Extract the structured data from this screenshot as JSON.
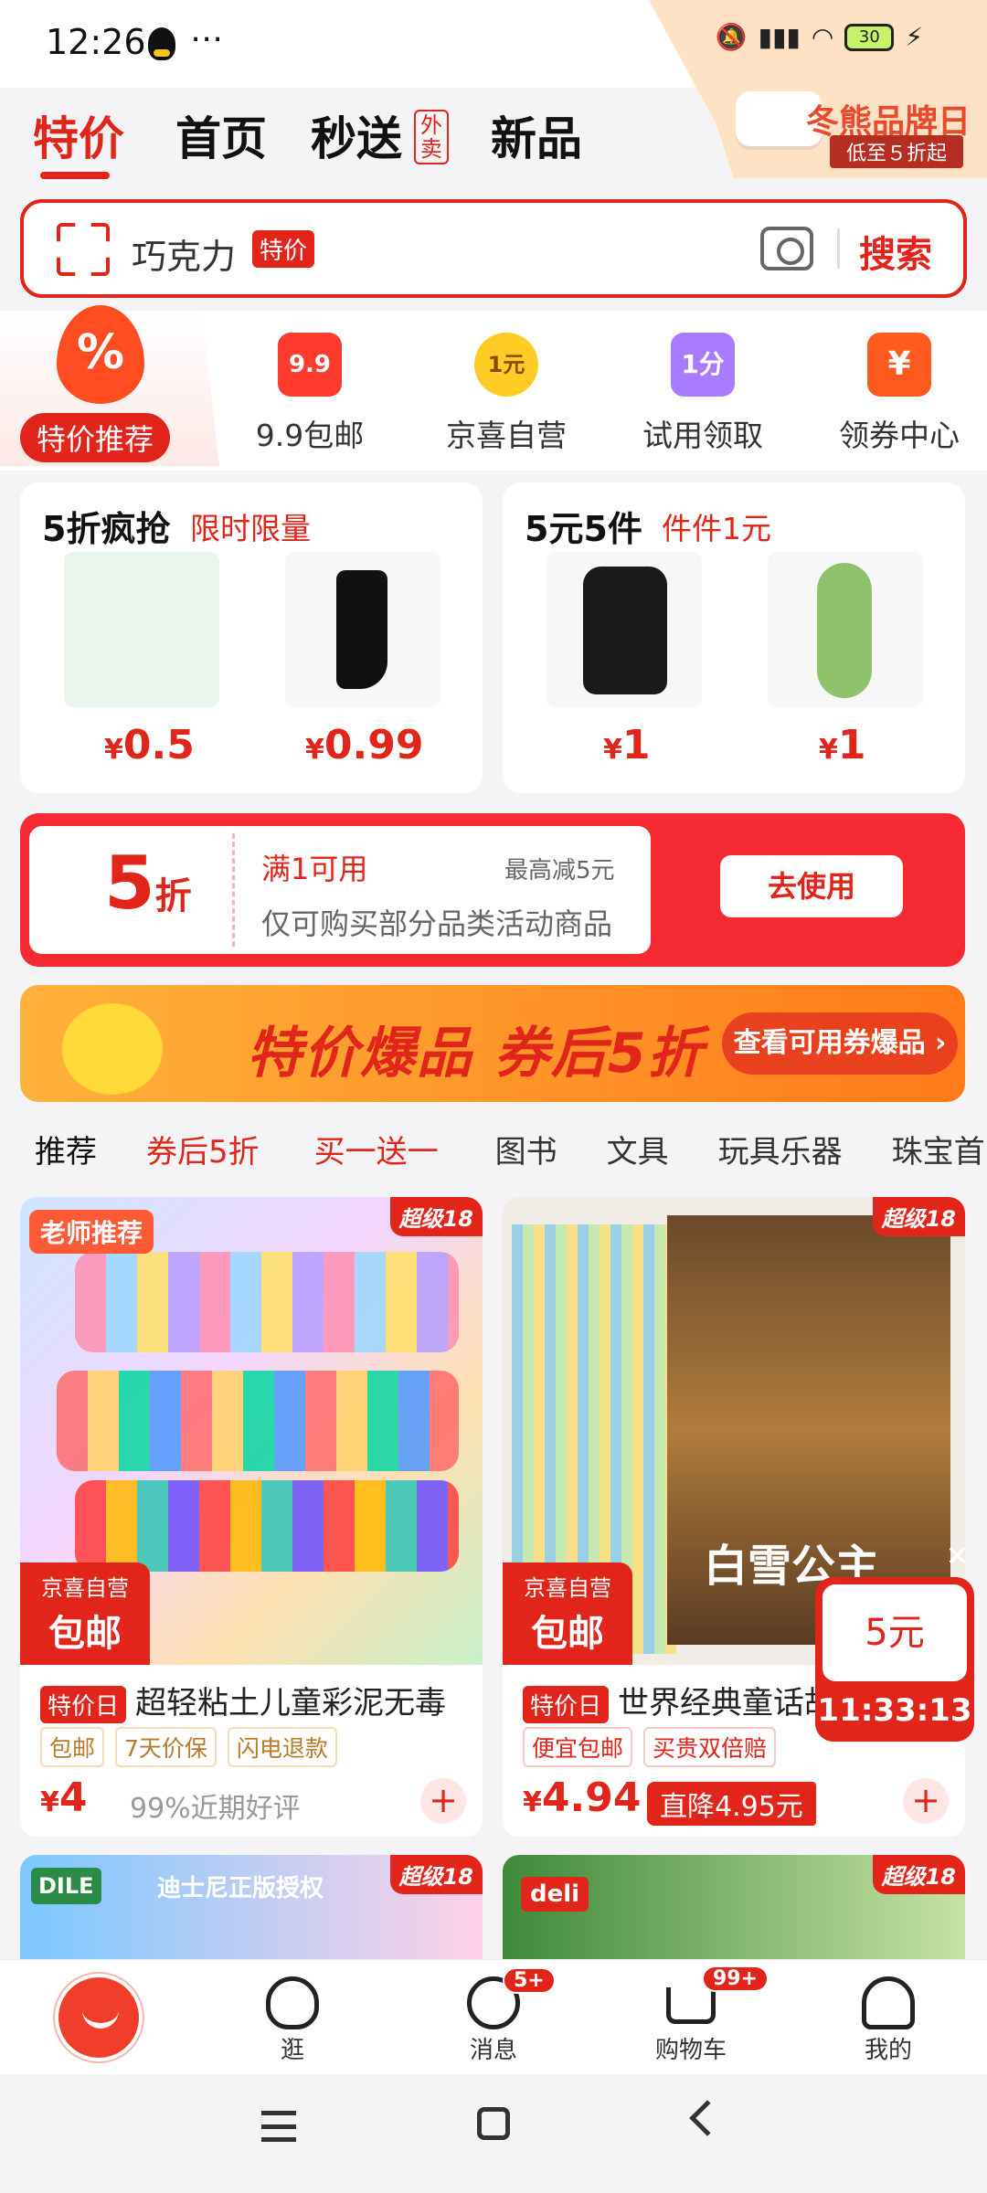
{
  "status": {
    "time": "12:26",
    "battery": "30"
  },
  "promo": {
    "title": "冬熊品牌日",
    "sub": "低至５折起"
  },
  "tabs": [
    {
      "label": "特价"
    },
    {
      "label": "首页"
    },
    {
      "label": "秒送"
    },
    {
      "label": "新品"
    }
  ],
  "tab_sub": "外卖",
  "search": {
    "keyword": "巧克力",
    "tag": "特价",
    "button": "搜索"
  },
  "quick": [
    {
      "label": "特价推荐",
      "icon": "fire-percent-icon"
    },
    {
      "label": "9.9包邮",
      "icon": "gift-box-icon",
      "glyph": "9.9"
    },
    {
      "label": "京喜自营",
      "icon": "badge-icon",
      "glyph": "1元"
    },
    {
      "label": "试用领取",
      "icon": "bag-icon",
      "glyph": "1分"
    },
    {
      "label": "领券中心",
      "icon": "coupon-icon",
      "glyph": "¥"
    }
  ],
  "deals": [
    {
      "title": "5折疯抢",
      "sub": "限时限量",
      "items": [
        {
          "price": "0.5"
        },
        {
          "price": "0.99"
        }
      ]
    },
    {
      "title": "5元5件",
      "sub": "件件1元",
      "items": [
        {
          "price": "1"
        },
        {
          "price": "1"
        }
      ]
    }
  ],
  "currency": "¥",
  "coupon": {
    "value": "5",
    "unit": "折",
    "cond": "满1可用",
    "max": "最高减5元",
    "desc": "仅可购买部分品类活动商品",
    "button": "去使用"
  },
  "banner": {
    "title": "特价爆品 券后5折",
    "button": "查看可用券爆品 ›"
  },
  "categories": [
    "推荐",
    "券后5折",
    "买一送一",
    "图书",
    "文具",
    "玩具乐器",
    "珠宝首"
  ],
  "products": [
    {
      "badge": "超级18",
      "promo_top": "老师推荐",
      "self": "京喜自营",
      "ship": "包邮",
      "tag": "特价日",
      "title": "超轻粘土儿童彩泥无毒",
      "chips": [
        "包邮",
        "7天价保",
        "闪电退款"
      ],
      "price": "4",
      "note": "99%近期好评",
      "add": "+"
    },
    {
      "badge": "超级18",
      "self": "京喜自营",
      "ship": "包邮",
      "tag": "特价日",
      "title": "世界经典童话故事",
      "book_title": "白雪公主",
      "chips": [
        "便宜包邮",
        "买贵双倍赔"
      ],
      "price": "4.94",
      "drop": "直降4.95元",
      "add": "+"
    },
    {
      "badge": "超级18",
      "brand": "DILE",
      "promo_top": "迪士尼正版授权"
    },
    {
      "badge": "超级18",
      "brand": "deli"
    }
  ],
  "timer": {
    "amount": "5元",
    "time": "11:33:13"
  },
  "bottom_nav": [
    {
      "label": ""
    },
    {
      "label": "逛"
    },
    {
      "label": "消息",
      "badge": "5+"
    },
    {
      "label": "购物车",
      "badge": "99+"
    },
    {
      "label": "我的"
    }
  ]
}
